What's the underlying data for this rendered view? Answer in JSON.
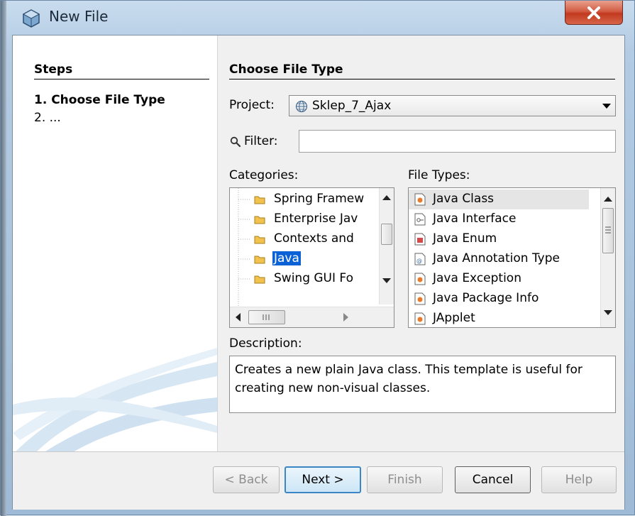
{
  "window": {
    "title": "New File",
    "close_glyph": "X"
  },
  "steps": {
    "title": "Steps",
    "items": [
      "1.  Choose File Type",
      "2.  ..."
    ]
  },
  "main": {
    "title": "Choose File Type",
    "project_label": "Project:",
    "project_value": "Sklep_7_Ajax",
    "filter_label": "Filter:",
    "filter_value": "",
    "categories_label": "Categories:",
    "file_types_label": "File Types:",
    "categories": [
      "Spring Framew",
      "Enterprise Jav",
      "Contexts and",
      "Java",
      "Swing GUI Fo"
    ],
    "selected_category": "Java",
    "file_types": [
      "Java Class",
      "Java Interface",
      "Java Enum",
      "Java Annotation Type",
      "Java Exception",
      "Java Package Info",
      "JApplet"
    ],
    "selected_file_type": "Java Class",
    "description_label": "Description:",
    "description": "Creates a new plain Java class. This template is useful for creating new non-visual classes."
  },
  "buttons": {
    "back": "< Back",
    "next": "Next >",
    "finish": "Finish",
    "cancel": "Cancel",
    "help": "Help"
  },
  "colors": {
    "selection": "#0a62d6",
    "close_button": "#c2391f",
    "title_bar": "#b3cbe3"
  }
}
